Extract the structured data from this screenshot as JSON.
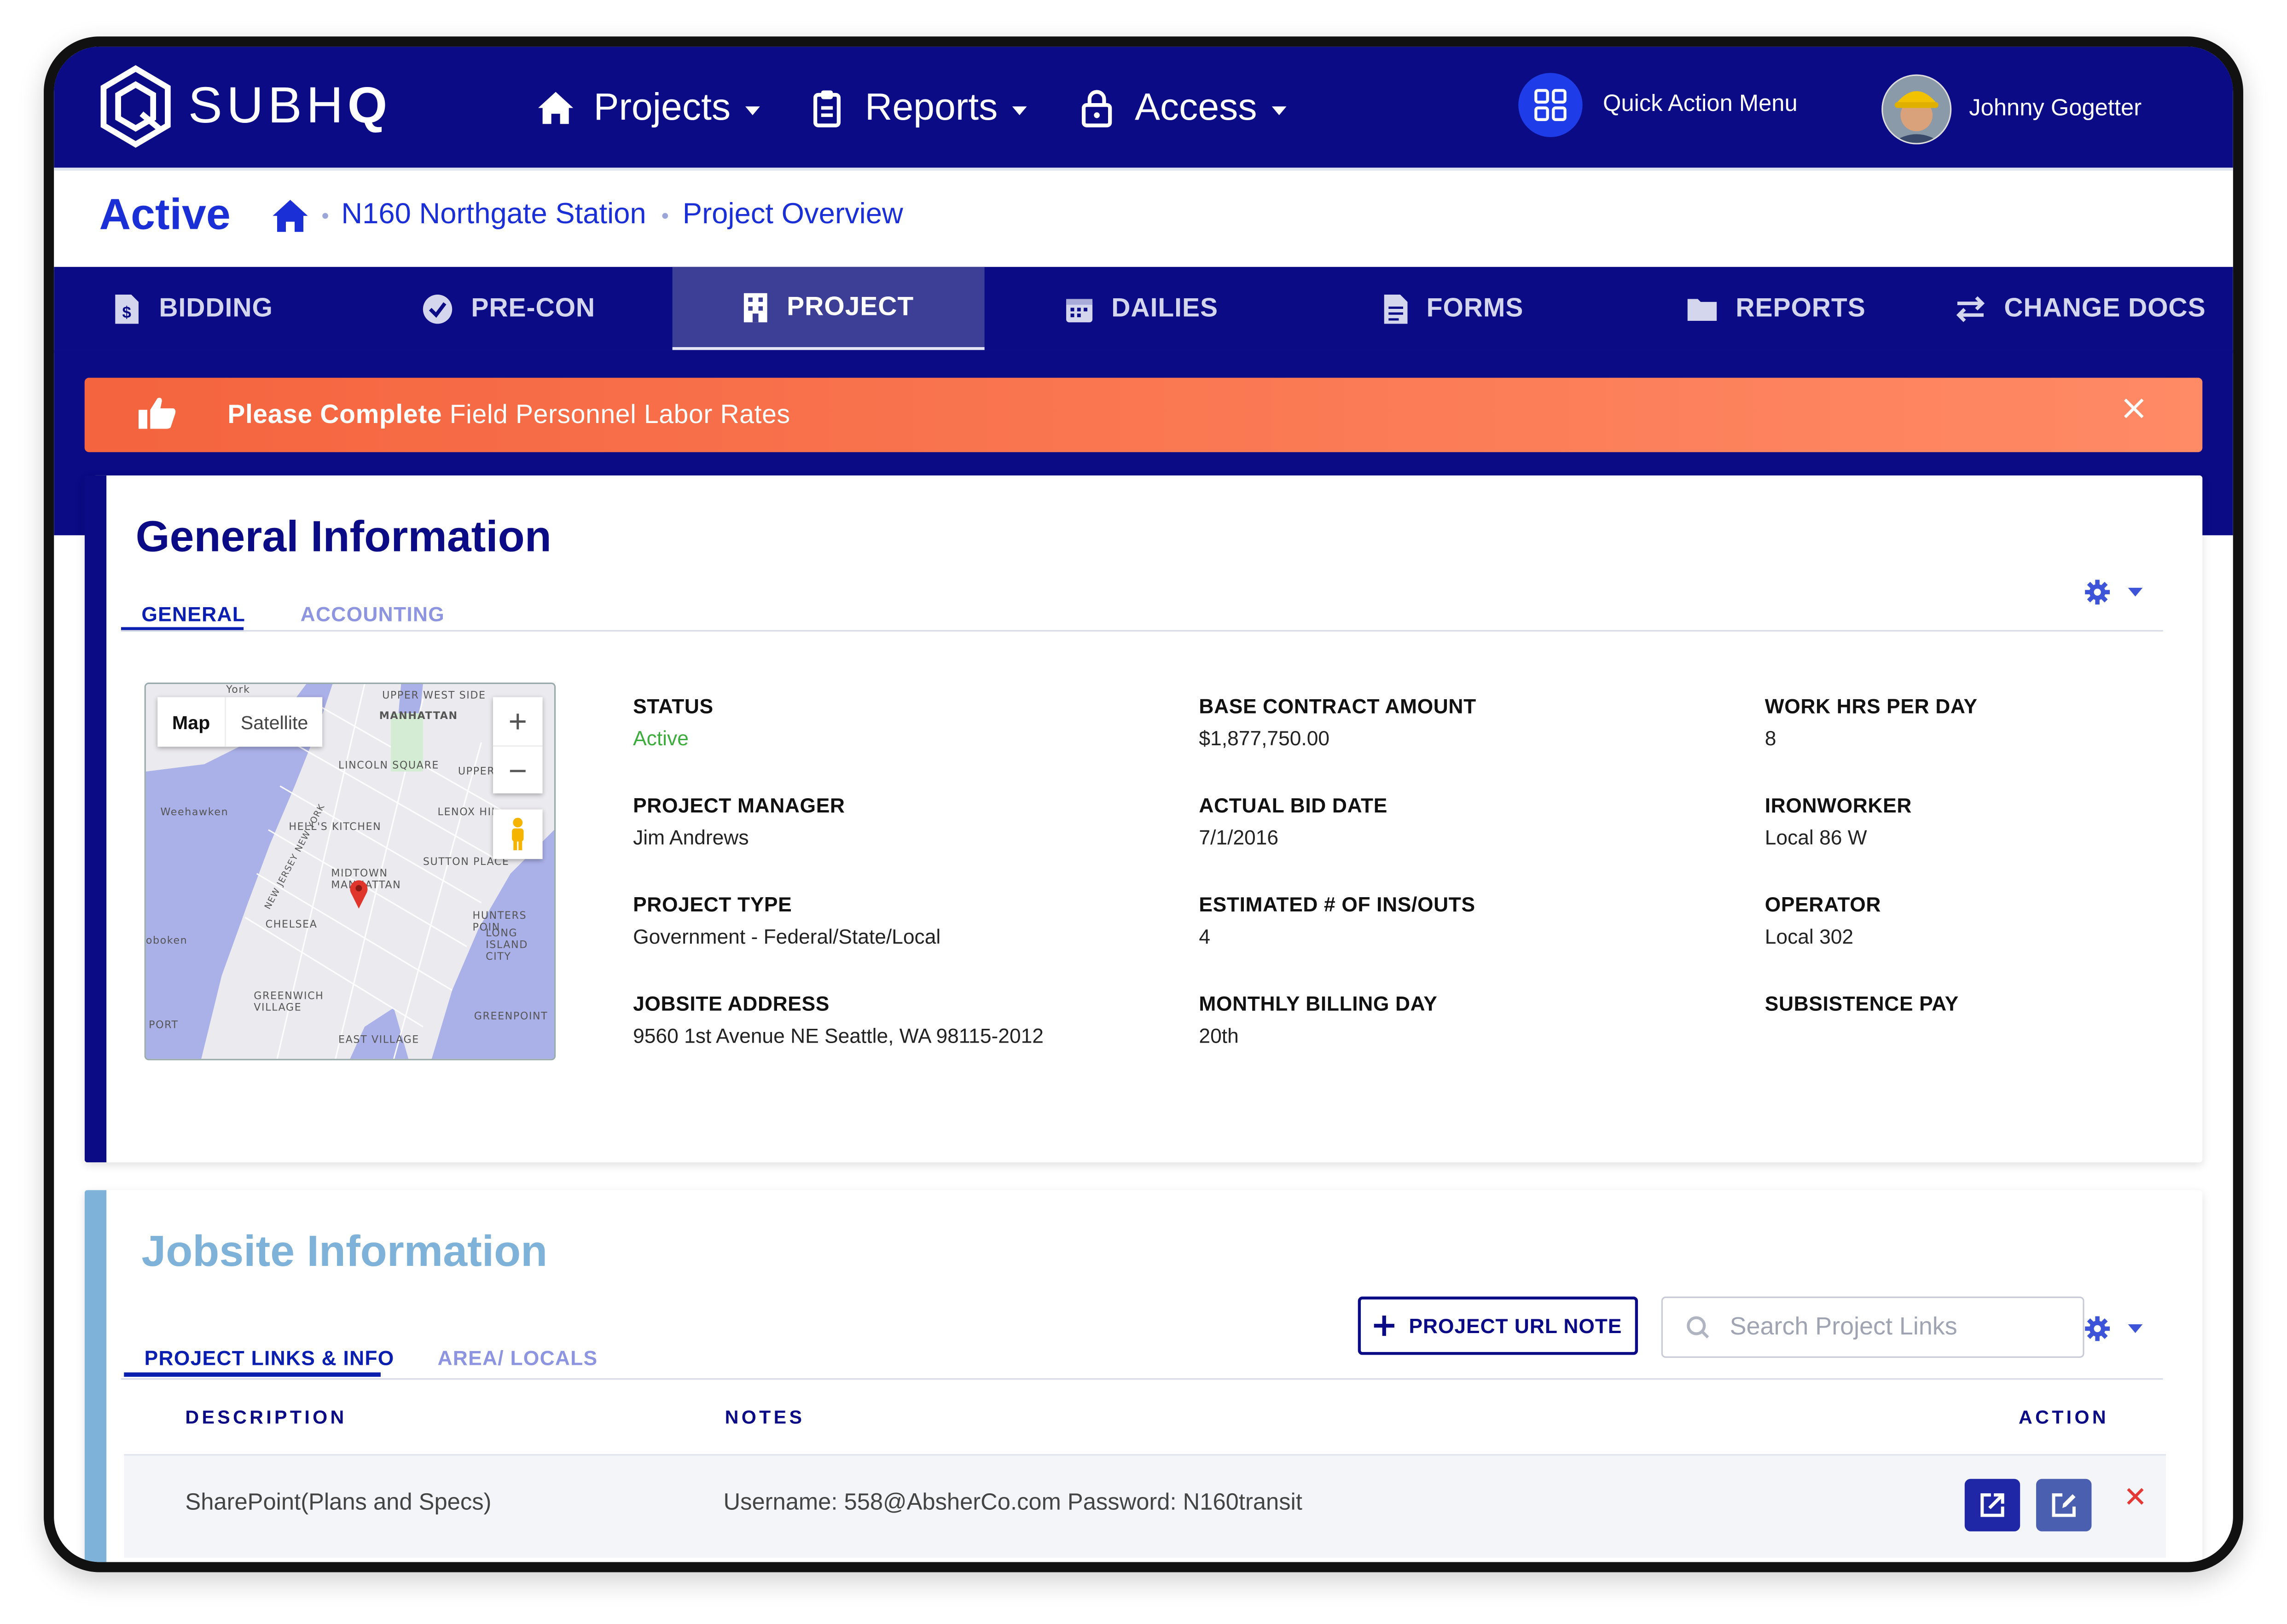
{
  "brand": {
    "name_light": "SUBH",
    "name_bold": "Q"
  },
  "nav": {
    "items": [
      {
        "label": "Projects"
      },
      {
        "label": "Reports"
      },
      {
        "label": "Access"
      }
    ],
    "quick_action": "Quick Action Menu",
    "user_name": "Johnny Gogetter"
  },
  "breadcrumb": {
    "status": "Active",
    "project": "N160 Northgate Station",
    "page": "Project Overview"
  },
  "tabs": [
    {
      "label": "BIDDING"
    },
    {
      "label": "PRE-CON"
    },
    {
      "label": "PROJECT"
    },
    {
      "label": "DAILIES"
    },
    {
      "label": "FORMS"
    },
    {
      "label": "REPORTS"
    },
    {
      "label": "CHANGE DOCS"
    }
  ],
  "active_tab": "PROJECT",
  "alert": {
    "bold": "Please Complete",
    "text": "Field Personnel Labor Rates"
  },
  "general": {
    "title": "General Information",
    "subtabs": [
      "GENERAL",
      "ACCOUNTING"
    ],
    "map": {
      "toggle_map": "Map",
      "toggle_satellite": "Satellite",
      "zoom_in": "+",
      "zoom_out": "−",
      "labels": [
        "UPPER WEST SIDE",
        "MANHATTAN",
        "LINCOLN SQUARE",
        "UPPER EAST S",
        "Weehawken",
        "HELL'S KITCHEN",
        "LENOX HIL",
        "NEW JERSEY NEW YORK",
        "SUTTON PLACE",
        "MIDTOWN MANHATTAN",
        "CHELSEA",
        "HUNTERS POIN",
        "LONG ISLAND CITY",
        "oboken",
        "GREENWICH VILLAGE",
        "GREENPOINT",
        "PORT",
        "EAST VILLAGE",
        "York"
      ]
    },
    "fields": [
      {
        "label": "STATUS",
        "value": "Active"
      },
      {
        "label": "PROJECT MANAGER",
        "value": "Jim Andrews"
      },
      {
        "label": "PROJECT TYPE",
        "value": "Government - Federal/State/Local"
      },
      {
        "label": "JOBSITE ADDRESS",
        "value": "9560 1st Avenue NE Seattle, WA 98115-2012"
      },
      {
        "label": "BASE CONTRACT AMOUNT",
        "value": "$1,877,750.00"
      },
      {
        "label": "ACTUAL BID DATE",
        "value": "7/1/2016"
      },
      {
        "label": "ESTIMATED # OF INS/OUTS",
        "value": "4"
      },
      {
        "label": "MONTHLY BILLING DAY",
        "value": "20th"
      },
      {
        "label": "WORK HRS PER DAY",
        "value": "8"
      },
      {
        "label": "IRONWORKER",
        "value": "Local 86 W"
      },
      {
        "label": "OPERATOR",
        "value": "Local 302"
      },
      {
        "label": "SUBSISTENCE PAY",
        "value": ""
      }
    ]
  },
  "jobsite": {
    "title": "Jobsite Information",
    "subtabs": [
      "PROJECT LINKS & INFO",
      "AREA/ LOCALS"
    ],
    "add_button": "PROJECT URL NOTE",
    "search_placeholder": "Search Project Links",
    "columns": [
      "DESCRIPTION",
      "NOTES",
      "ACTION"
    ],
    "rows": [
      {
        "description": "SharePoint(Plans and Specs)",
        "notes": "Username: 558@AbsherCo.com Password: N160transit"
      }
    ]
  },
  "colors": {
    "navy": "#0a0b85",
    "accent_blue": "#1a2fd6",
    "alert_orange": "#f4643e",
    "status_green": "#3cad3c",
    "light_blue": "#7fb2d8"
  },
  "icons": [
    "logo-icon",
    "home-icon",
    "clipboard-icon",
    "lock-icon",
    "grid-icon",
    "avatar",
    "dollar-file-icon",
    "check-circle-icon",
    "building-icon",
    "calendar-icon",
    "document-icon",
    "folder-icon",
    "exchange-icon",
    "thumbs-up-icon",
    "close-icon",
    "gear-icon",
    "map-pin-icon",
    "pegman-icon",
    "plus-icon",
    "search-icon",
    "external-link-icon",
    "edit-icon"
  ]
}
